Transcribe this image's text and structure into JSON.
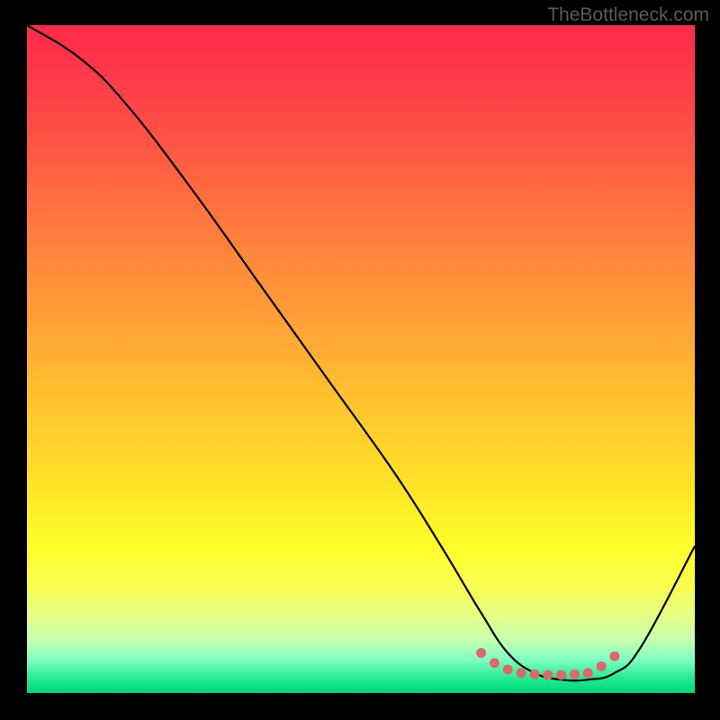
{
  "watermark": "TheBottleneck.com",
  "chart_data": {
    "type": "line",
    "title": "",
    "xlabel": "",
    "ylabel": "",
    "xlim": [
      0,
      100
    ],
    "ylim": [
      0,
      100
    ],
    "series": [
      {
        "name": "bottleneck-curve",
        "x": [
          0,
          8,
          15,
          25,
          35,
          45,
          55,
          62,
          68,
          72,
          76,
          80,
          84,
          88,
          92,
          100
        ],
        "y": [
          100,
          95,
          88,
          75,
          61,
          47,
          33,
          22,
          12,
          6,
          3,
          2,
          2,
          3,
          7,
          22
        ]
      }
    ],
    "markers": {
      "name": "minimum-region-dots",
      "x": [
        68,
        70,
        72,
        74,
        76,
        78,
        80,
        82,
        84,
        86,
        88
      ],
      "y": [
        6,
        4.5,
        3.5,
        3,
        2.8,
        2.7,
        2.7,
        2.8,
        3,
        4,
        5.5
      ]
    },
    "colors": {
      "curve": "#000000",
      "markers": "#d96a6a",
      "gradient_top": "#ff2a4a",
      "gradient_bottom": "#00d878"
    }
  }
}
